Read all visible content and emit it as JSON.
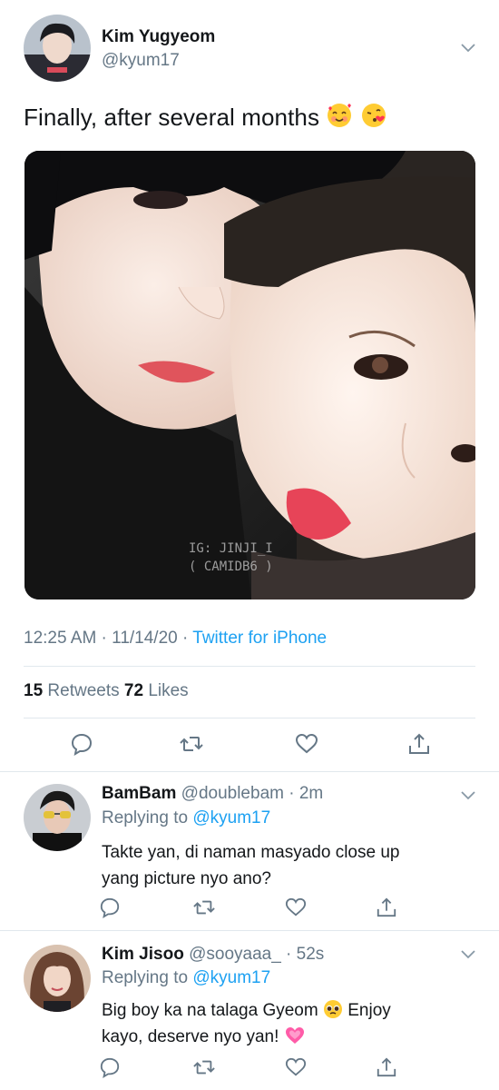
{
  "tweet": {
    "author_name": "Kim Yugyeom",
    "author_handle": "@kyum17",
    "text": "Finally, after several months",
    "emojis": [
      "smiling-face-with-hearts",
      "face-blowing-kiss"
    ],
    "watermark_line1": "IG: JINJI_I",
    "watermark_line2": "( CAMIDB6 )",
    "time": "12:25 AM · 11/14/20 · ",
    "source": "Twitter for iPhone",
    "retweets_count": "15",
    "retweets_label": " Retweets ",
    "likes_count": "72",
    "likes_label": " Likes"
  },
  "actions": [
    "reply-icon",
    "retweet-icon",
    "like-icon",
    "share-icon"
  ],
  "replies": [
    {
      "name": "BamBam",
      "handle": " @doublebam · 2m",
      "replying_label": "Replying to ",
      "replying_to": "@kyum17",
      "line1": "Takte yan, di naman masyado close up",
      "line2": "yang picture nyo ano?"
    },
    {
      "name": "Kim Jisoo",
      "handle": " @sooyaaa_ · 52s",
      "replying_label": "Replying to ",
      "replying_to": "@kyum17",
      "line1": "Big boy ka na talaga Gyeom",
      "line1_after": " Enjoy",
      "line2": "kayo, deserve nyo yan! ",
      "emojis": [
        "pleading-face",
        "growing-heart"
      ]
    }
  ],
  "colors": {
    "link": "#1da1f2",
    "secondary_text": "#657786",
    "primary_text": "#14171a",
    "divider": "#e1e8ed"
  }
}
